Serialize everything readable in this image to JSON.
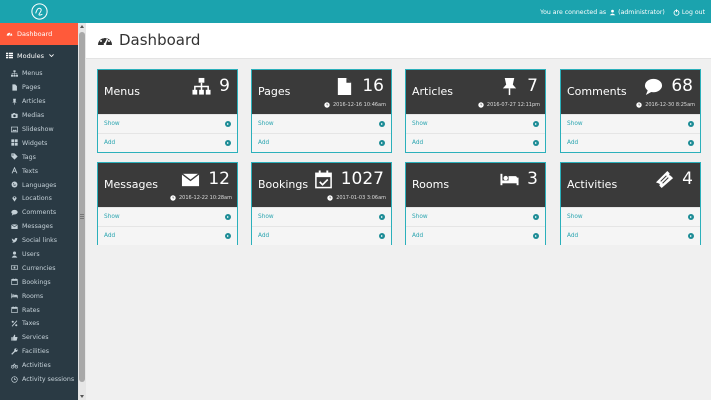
{
  "topbar": {
    "connected_text": "You are connected as",
    "username": "(administrator)",
    "logout_label": "Log out"
  },
  "sidebar": {
    "dashboard_label": "Dashboard",
    "modules_label": "Modules",
    "items": [
      {
        "label": "Menus",
        "icon": "sitemap-icon"
      },
      {
        "label": "Pages",
        "icon": "file-icon"
      },
      {
        "label": "Articles",
        "icon": "thumbtack-icon"
      },
      {
        "label": "Medias",
        "icon": "camera-icon"
      },
      {
        "label": "Slideshow",
        "icon": "image-icon"
      },
      {
        "label": "Widgets",
        "icon": "grid-icon"
      },
      {
        "label": "Tags",
        "icon": "tag-icon"
      },
      {
        "label": "Texts",
        "icon": "text-icon"
      },
      {
        "label": "Languages",
        "icon": "globe-icon"
      },
      {
        "label": "Locations",
        "icon": "map-marker-icon"
      },
      {
        "label": "Comments",
        "icon": "comment-icon"
      },
      {
        "label": "Messages",
        "icon": "envelope-icon"
      },
      {
        "label": "Social links",
        "icon": "twitter-icon"
      },
      {
        "label": "Users",
        "icon": "user-icon"
      },
      {
        "label": "Currencies",
        "icon": "money-icon"
      },
      {
        "label": "Bookings",
        "icon": "calendar-icon"
      },
      {
        "label": "Rooms",
        "icon": "bed-icon"
      },
      {
        "label": "Rates",
        "icon": "calendar-icon"
      },
      {
        "label": "Taxes",
        "icon": "percent-icon"
      },
      {
        "label": "Services",
        "icon": "thumbs-up-icon"
      },
      {
        "label": "Facilities",
        "icon": "wrench-icon"
      },
      {
        "label": "Activities",
        "icon": "bicycle-icon"
      },
      {
        "label": "Activity sessions",
        "icon": "clock-icon"
      }
    ]
  },
  "main": {
    "title": "Dashboard",
    "cards": [
      {
        "title": "Menus",
        "count": "9",
        "date": "",
        "show": "Show",
        "add": "Add",
        "icon": "sitemap-icon"
      },
      {
        "title": "Pages",
        "count": "16",
        "date": "2016-12-16 10:46am",
        "show": "Show",
        "add": "Add",
        "icon": "file-icon"
      },
      {
        "title": "Articles",
        "count": "7",
        "date": "2016-07-27 12:11pm",
        "show": "Show",
        "add": "Add",
        "icon": "thumbtack-icon"
      },
      {
        "title": "Comments",
        "count": "68",
        "date": "2016-12-30 8:25am",
        "show": "Show",
        "add": "Add",
        "icon": "comment-icon"
      },
      {
        "title": "Messages",
        "count": "12",
        "date": "2016-12-22 10:28am",
        "show": "Show",
        "add": "Add",
        "icon": "envelope-icon"
      },
      {
        "title": "Bookings",
        "count": "1027",
        "date": "2017-01-03 3:06am",
        "show": "Show",
        "add": "Add",
        "icon": "calendar-check-icon"
      },
      {
        "title": "Rooms",
        "count": "3",
        "date": "",
        "show": "Show",
        "add": "Add",
        "icon": "bed-icon"
      },
      {
        "title": "Activities",
        "count": "4",
        "date": "",
        "show": "Show",
        "add": "Add",
        "icon": "ticket-icon"
      }
    ]
  },
  "colors": {
    "topbar": "#1ba3ae",
    "active_nav": "#ff5a3a",
    "sidebar": "#2a3a44",
    "card_header": "#3a3a3a",
    "card_border": "#2bb0bb"
  }
}
